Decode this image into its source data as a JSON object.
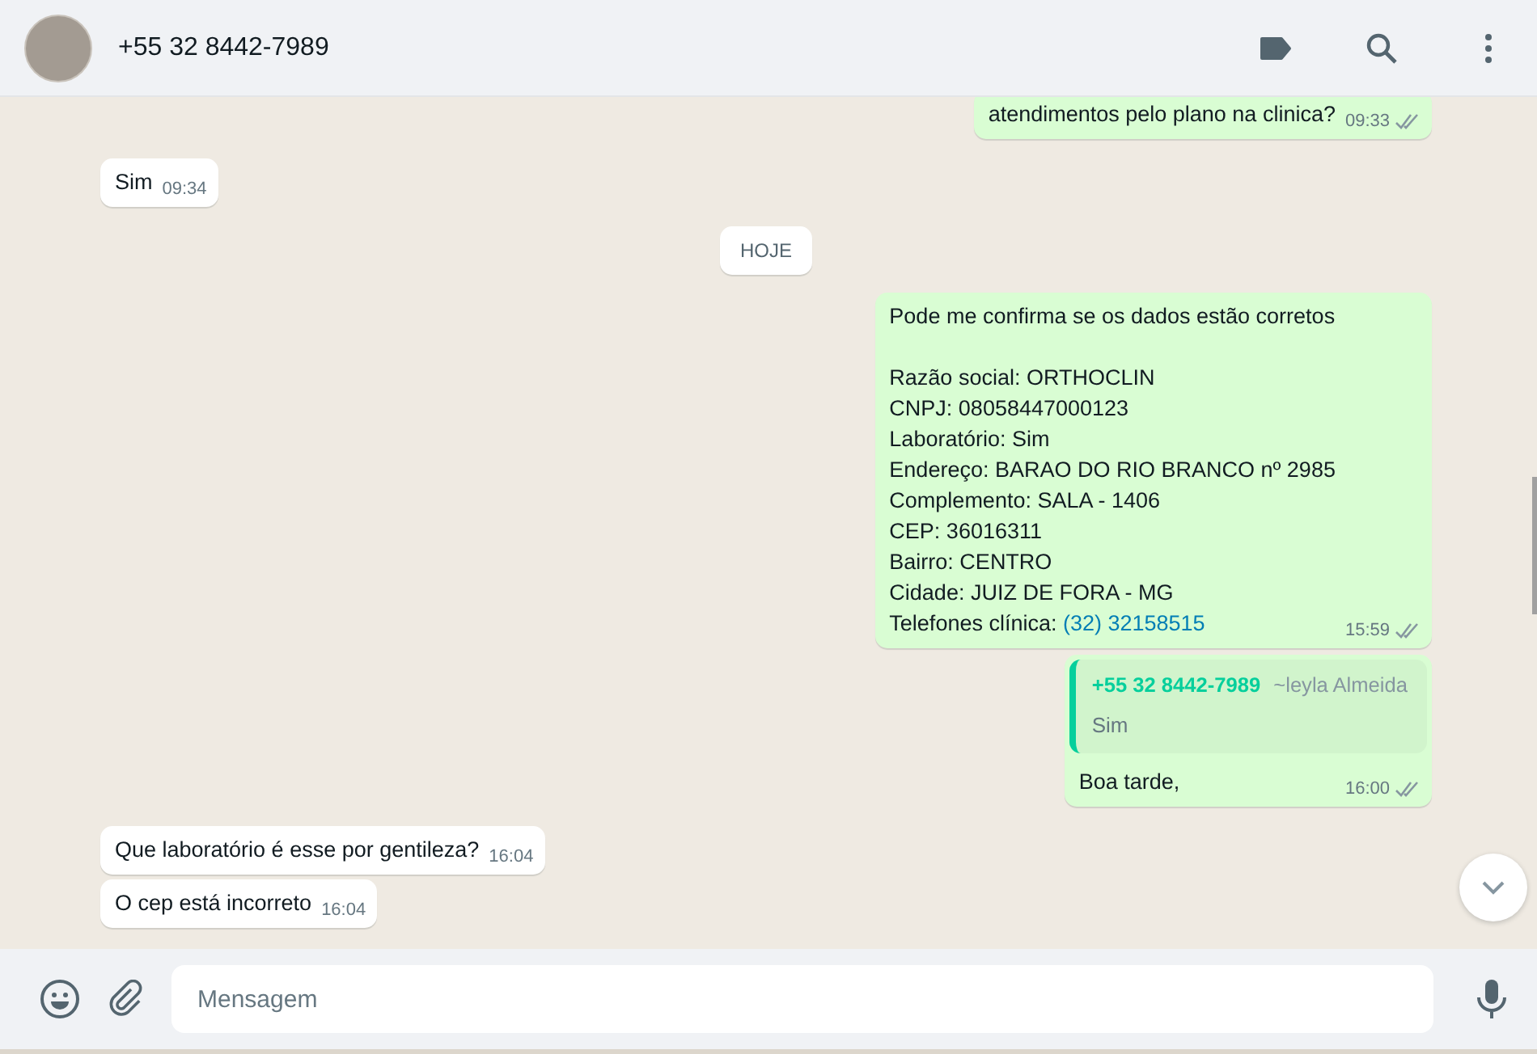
{
  "header": {
    "contact": "+55 32 8442-7989"
  },
  "messages": [
    {
      "kind": "out",
      "text": "atendimentos pelo plano na clinica?",
      "time": "09:33",
      "read": false
    },
    {
      "kind": "in",
      "text": "Sim",
      "time": "09:34"
    },
    {
      "kind": "date",
      "text": "HOJE"
    },
    {
      "kind": "out",
      "text": "Pode me confirma se os dados estão corretos\n\nRazão social: ORTHOCLIN\nCNPJ: 08058447000123\nLaboratório: Sim\nEndereço: BARAO DO RIO BRANCO nº 2985\nComplemento: SALA - 1406\nCEP: 36016311\nBairro: CENTRO\nCidade: JUIZ DE FORA - MG\nTelefones clínica: ",
      "link": "(32) 32158515",
      "time": "15:59",
      "read": false
    },
    {
      "kind": "out",
      "quote": {
        "author": "+55 32 8442-7989",
        "push_name": "~leyla Almeida",
        "text": "Sim"
      },
      "text": "Boa tarde,",
      "time": "16:00",
      "read": false
    },
    {
      "kind": "in",
      "text": "Que laboratório é esse por gentileza?",
      "time": "16:04"
    },
    {
      "kind": "in",
      "text": "O cep está incorreto",
      "time": "16:04"
    }
  ],
  "composer": {
    "placeholder": "Mensagem"
  }
}
